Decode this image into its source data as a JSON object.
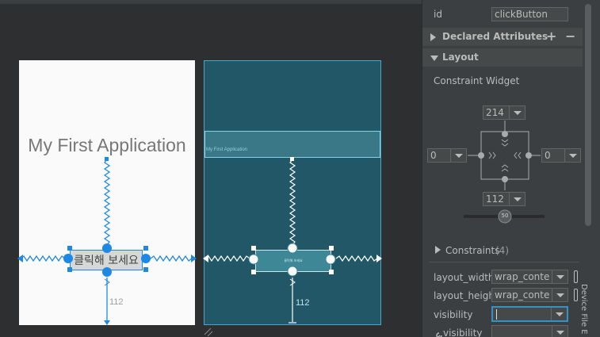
{
  "design": {
    "title_text": "My First Application",
    "button_text": "클릭해 보세요",
    "bottom_margin": "112"
  },
  "blueprint": {
    "title_text": "My First Application",
    "button_text": "클릭해 보세요",
    "bottom_margin": "112"
  },
  "panel": {
    "id_label": "id",
    "id_value": "clickButton",
    "declared_attributes_label": "Declared Attributes",
    "layout_label": "Layout",
    "constraint_widget_label": "Constraint Widget",
    "margin_top": "214",
    "margin_left": "0",
    "margin_right": "0",
    "margin_bottom": "112",
    "bias_value": "50",
    "constraints_label": "Constraints",
    "constraints_count": "(4)",
    "layout_width_label": "layout_width",
    "layout_width_value": "wrap_content",
    "layout_height_label": "layout_height",
    "layout_height_value": "wrap_content",
    "visibility_label": "visibility",
    "visibility_value": "",
    "tool_visibility_label": "visibility",
    "tool_visibility_value": "",
    "side_tab_label": "Device File E"
  },
  "colors": {
    "accent_blue": "#1e88e5",
    "blueprint_bg": "#215767",
    "panel_bg": "#3c3f41"
  }
}
